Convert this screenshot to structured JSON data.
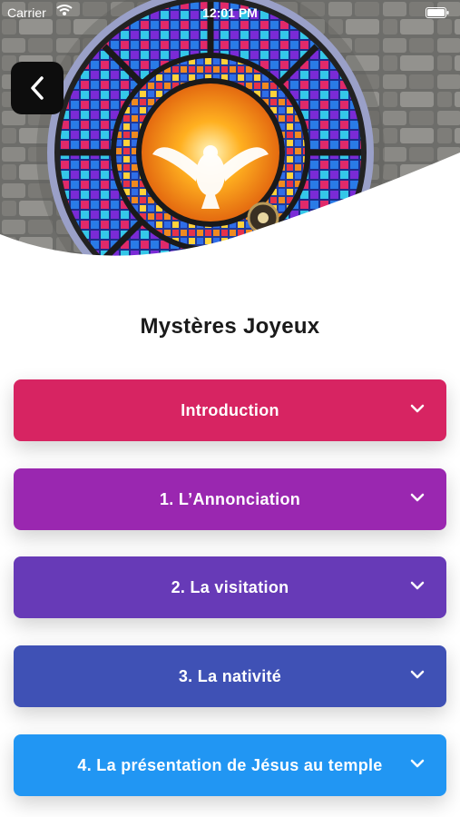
{
  "status_bar": {
    "carrier": "Carrier",
    "time": "12:01 PM"
  },
  "header": {
    "title": "Mystères Joyeux"
  },
  "sections": [
    {
      "label": "Introduction",
      "color": "#d72462"
    },
    {
      "label": "1. L’Annonciation",
      "color": "#9a27b0"
    },
    {
      "label": "2. La visitation",
      "color": "#673ab7"
    },
    {
      "label": "3. La nativité",
      "color": "#3f51b5"
    },
    {
      "label": "4. La présentation de Jésus au temple",
      "color": "#2196f3"
    }
  ],
  "icons": {
    "back": "chevron-left-icon",
    "expand": "chevron-down-icon"
  }
}
